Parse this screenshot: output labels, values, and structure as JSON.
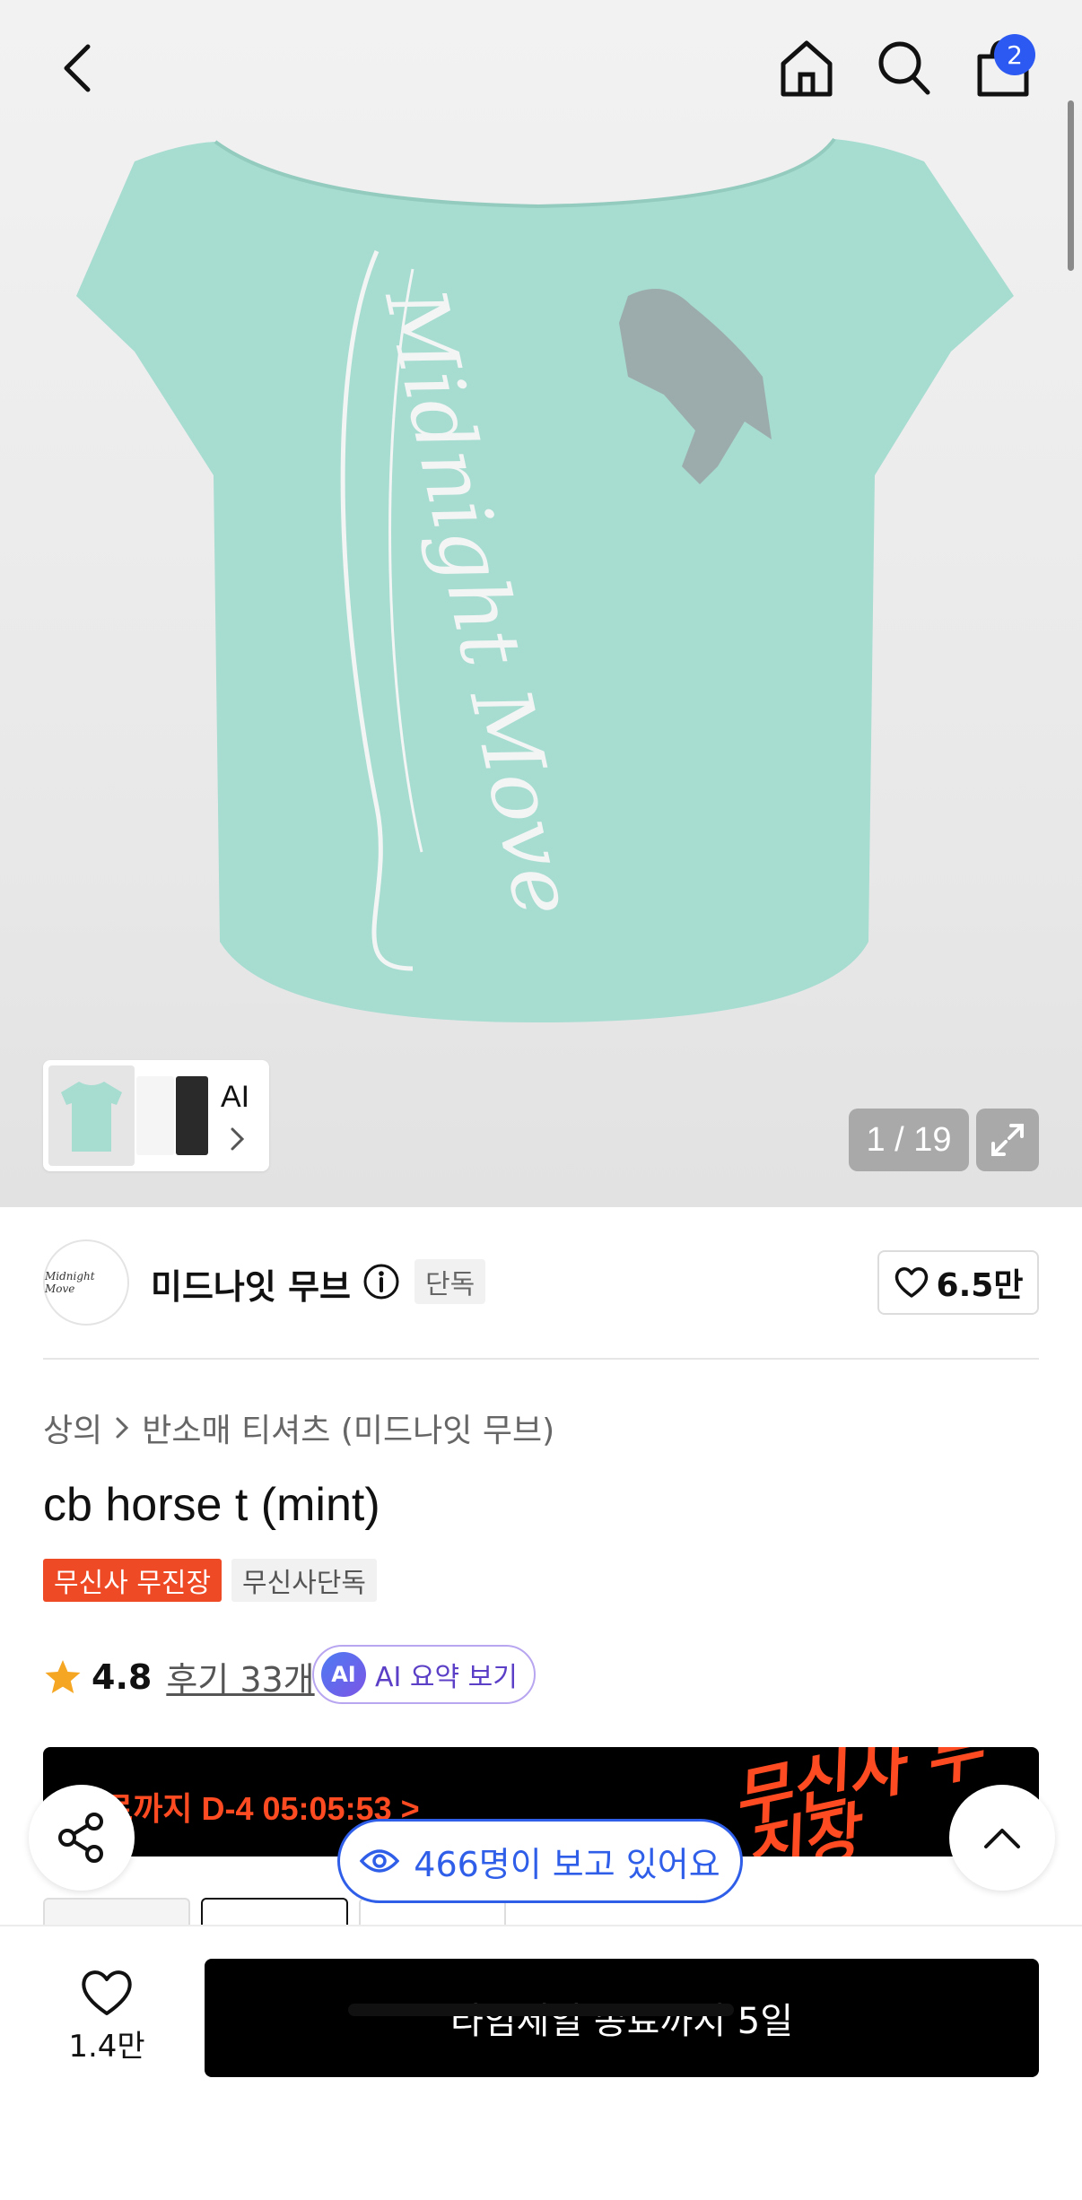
{
  "header": {
    "back_icon": "chevron-left-icon",
    "home_icon": "home-icon",
    "search_icon": "search-icon",
    "cart_icon": "shopping-bag-icon",
    "cart_count": "2"
  },
  "gallery": {
    "ai_label": "AI",
    "counter": "1 / 19",
    "expand_icon": "expand-icon",
    "shirt_print_text": "Midnight Move"
  },
  "brand": {
    "logo_text": "Midnight Move",
    "name": "미드나잇 무브",
    "info_icon": "info-icon",
    "exclusive_tag": "단독",
    "likes": "6.5만"
  },
  "product": {
    "breadcrumb": [
      "상의",
      "반소매 티셔츠 (미드나잇 무브)"
    ],
    "title": "cb horse t (mint)",
    "tags": [
      "무신사 무진장",
      "무신사단독"
    ],
    "rating": "4.8",
    "reviews": "후기 33개",
    "ai_summary": "AI 요약 보기",
    "ai_badge": "AI"
  },
  "sale_banner": {
    "countdown": "종료까지 D-4 05:05:53 >",
    "brandmark": "무신사 무진장"
  },
  "floating": {
    "viewers": "466명이 보고 있어요"
  },
  "bottom": {
    "wish_count": "1.4만",
    "buy_label": "타임세일 종료까지 5일"
  },
  "colors": {
    "accent_blue": "#2f5ee9",
    "sale_red": "#ef4a26",
    "shirt_mint": "#a7dcd1"
  }
}
